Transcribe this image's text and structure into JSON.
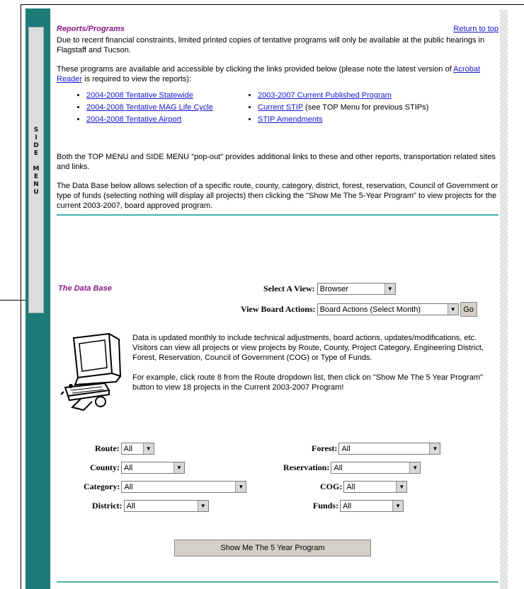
{
  "side_menu": {
    "label": "SIDE MENU",
    "letters": [
      "S",
      "I",
      "D",
      "E",
      "",
      "M",
      "E",
      "N",
      "U"
    ]
  },
  "reports": {
    "title": "Reports/Programs",
    "return_link": "Return to top",
    "intro": "Due to recent financial constraints, limited printed copies of tentative programs will only be available at the public hearings in Flagstaff and Tucson.",
    "access_pre": "These programs are available and accessible by clicking the links provided below (please note the latest version of ",
    "acrobat_link": "Acrobat Reader",
    "access_post": " is required to view the reports):",
    "links_left": [
      "2004-2008 Tentative Statewide",
      "2004-2008 Tentative MAG Life Cycle",
      "2004-2008 Tentative Airport"
    ],
    "links_right": [
      {
        "link": "2003-2007 Current Published Program",
        "after": ""
      },
      {
        "link": "Current  STIP",
        "after": " (see TOP Menu for previous STIPs)"
      },
      {
        "link": "STIP  Amendments",
        "after": ""
      }
    ],
    "popout_text": "Both the TOP MENU and SIDE MENU \"pop-out\" provides additional links to these and other reports, transportation related sites and links.",
    "database_text": "The Data Base below allows selection of a specific route, county, category, district, forest, reservation, Council of Government or type of funds (selecting nothing will display all projects) then clicking the \"Show Me The 5-Year Program\" to view projects for the current 2003-2007, board approved program."
  },
  "database": {
    "title": "The Data Base",
    "select_view_label": "Select A View:",
    "select_view_value": "Browser",
    "board_actions_label": "View Board Actions:",
    "board_actions_value": "Board Actions (Select Month)",
    "go_label": "Go",
    "info_text": "Data is updated monthly to include technical adjustments, board actions, updates/modifications, etc. Visitors can view all projects or view projects by Route, County, Project Category,  Engineering District, Forest, Reservation, Council of Government (COG) or Type of Funds.",
    "example_text": "For example, click route 8 from the Route dropdown list, then click on \"Show Me The 5 Year Program\" button to view 18 projects in the Current 2003-2007 Program!",
    "filters": {
      "route": {
        "label": "Route:",
        "value": "All"
      },
      "county": {
        "label": "County:",
        "value": "All"
      },
      "category": {
        "label": "Category:",
        "value": "All"
      },
      "district": {
        "label": "District:",
        "value": "All"
      },
      "forest": {
        "label": "Forest:",
        "value": "All"
      },
      "reservation": {
        "label": "Reservation:",
        "value": "All"
      },
      "cog": {
        "label": "COG:",
        "value": "All"
      },
      "funds": {
        "label": "Funds:",
        "value": "All"
      }
    },
    "submit_label": "Show Me The 5 Year Program"
  }
}
